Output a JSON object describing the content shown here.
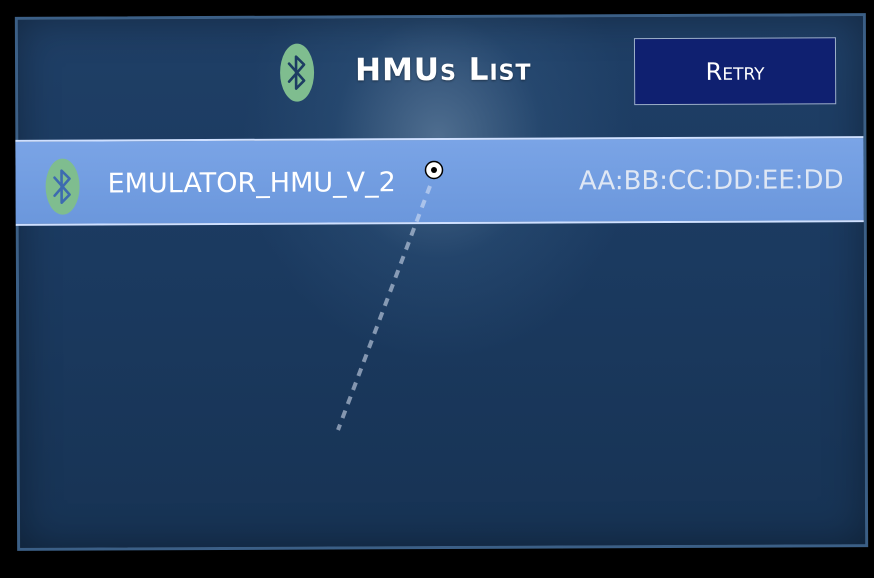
{
  "header": {
    "title": "HMUs List",
    "retry_label": "Retry",
    "bluetooth_icon": "bluetooth-icon"
  },
  "hmu_list": {
    "items": [
      {
        "name": "EMULATOR_HMU_V_2",
        "mac": "AA:BB:CC:DD:EE:DD",
        "icon": "bluetooth-icon",
        "selected": true
      }
    ]
  },
  "colors": {
    "panel_background": "#1b3a60",
    "selected_row": "#6b97dc",
    "bluetooth_badge": "#7fbd8f",
    "retry_button": "#0f2070"
  }
}
